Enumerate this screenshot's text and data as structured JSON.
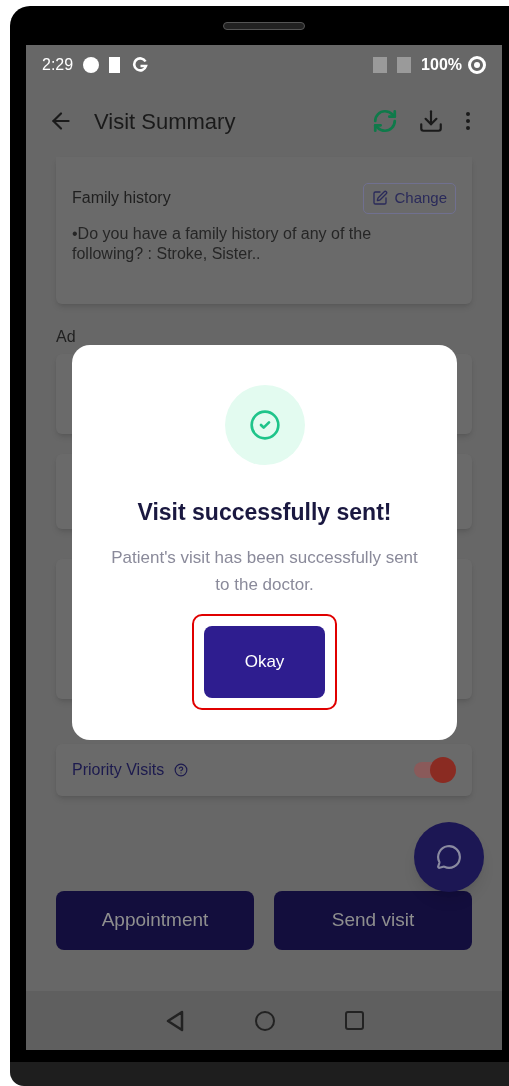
{
  "status_bar": {
    "time": "2:29",
    "battery": "100%"
  },
  "app_bar": {
    "title": "Visit Summary"
  },
  "family_history": {
    "title": "Family history",
    "action": "Change",
    "text": "•Do you have a family history of any of the following? : Stroke, Sister.."
  },
  "section_heading": "Ad",
  "priority": {
    "label": "Priority Visits",
    "on": true
  },
  "buttons": [
    "Appointment",
    "Send visit"
  ],
  "dialog": {
    "title": "Visit successfully sent!",
    "message": "Patient's visit has been successfully sent to the doctor.",
    "button": "Okay",
    "highlighted": true
  }
}
